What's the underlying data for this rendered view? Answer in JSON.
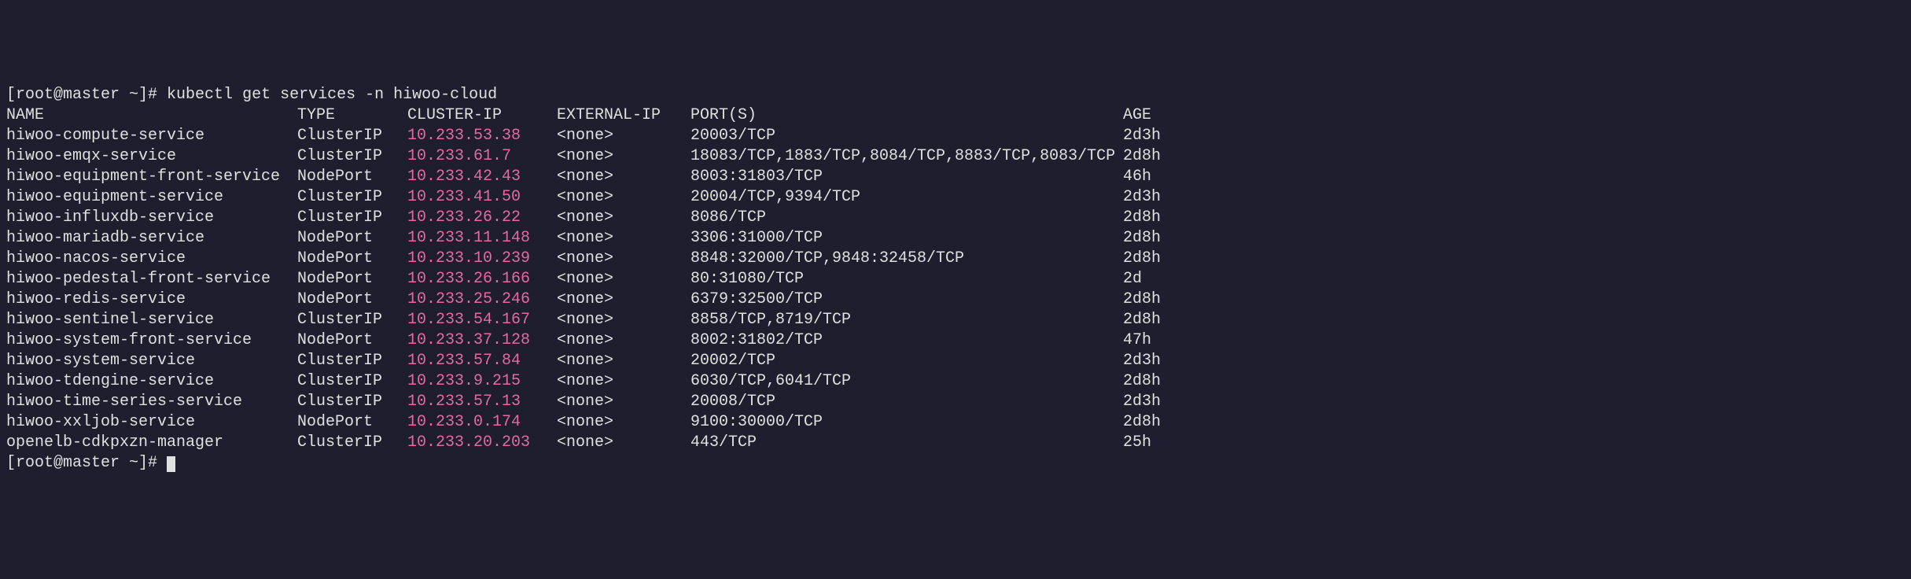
{
  "prompt1": "[root@master ~]# ",
  "command": "kubectl get services -n hiwoo-cloud",
  "prompt2": "[root@master ~]# ",
  "headers": {
    "name": "NAME",
    "type": "TYPE",
    "clusterip": "CLUSTER-IP",
    "externalip": "EXTERNAL-IP",
    "ports": "PORT(S)",
    "age": "AGE"
  },
  "services": [
    {
      "name": "hiwoo-compute-service",
      "type": "ClusterIP",
      "clusterip": "10.233.53.38",
      "externalip": "<none>",
      "ports": "20003/TCP",
      "age": "2d3h"
    },
    {
      "name": "hiwoo-emqx-service",
      "type": "ClusterIP",
      "clusterip": "10.233.61.7",
      "externalip": "<none>",
      "ports": "18083/TCP,1883/TCP,8084/TCP,8883/TCP,8083/TCP",
      "age": "2d8h"
    },
    {
      "name": "hiwoo-equipment-front-service",
      "type": "NodePort",
      "clusterip": "10.233.42.43",
      "externalip": "<none>",
      "ports": "8003:31803/TCP",
      "age": "46h"
    },
    {
      "name": "hiwoo-equipment-service",
      "type": "ClusterIP",
      "clusterip": "10.233.41.50",
      "externalip": "<none>",
      "ports": "20004/TCP,9394/TCP",
      "age": "2d3h"
    },
    {
      "name": "hiwoo-influxdb-service",
      "type": "ClusterIP",
      "clusterip": "10.233.26.22",
      "externalip": "<none>",
      "ports": "8086/TCP",
      "age": "2d8h"
    },
    {
      "name": "hiwoo-mariadb-service",
      "type": "NodePort",
      "clusterip": "10.233.11.148",
      "externalip": "<none>",
      "ports": "3306:31000/TCP",
      "age": "2d8h"
    },
    {
      "name": "hiwoo-nacos-service",
      "type": "NodePort",
      "clusterip": "10.233.10.239",
      "externalip": "<none>",
      "ports": "8848:32000/TCP,9848:32458/TCP",
      "age": "2d8h"
    },
    {
      "name": "hiwoo-pedestal-front-service",
      "type": "NodePort",
      "clusterip": "10.233.26.166",
      "externalip": "<none>",
      "ports": "80:31080/TCP",
      "age": "2d"
    },
    {
      "name": "hiwoo-redis-service",
      "type": "NodePort",
      "clusterip": "10.233.25.246",
      "externalip": "<none>",
      "ports": "6379:32500/TCP",
      "age": "2d8h"
    },
    {
      "name": "hiwoo-sentinel-service",
      "type": "ClusterIP",
      "clusterip": "10.233.54.167",
      "externalip": "<none>",
      "ports": "8858/TCP,8719/TCP",
      "age": "2d8h"
    },
    {
      "name": "hiwoo-system-front-service",
      "type": "NodePort",
      "clusterip": "10.233.37.128",
      "externalip": "<none>",
      "ports": "8002:31802/TCP",
      "age": "47h"
    },
    {
      "name": "hiwoo-system-service",
      "type": "ClusterIP",
      "clusterip": "10.233.57.84",
      "externalip": "<none>",
      "ports": "20002/TCP",
      "age": "2d3h"
    },
    {
      "name": "hiwoo-tdengine-service",
      "type": "ClusterIP",
      "clusterip": "10.233.9.215",
      "externalip": "<none>",
      "ports": "6030/TCP,6041/TCP",
      "age": "2d8h"
    },
    {
      "name": "hiwoo-time-series-service",
      "type": "ClusterIP",
      "clusterip": "10.233.57.13",
      "externalip": "<none>",
      "ports": "20008/TCP",
      "age": "2d3h"
    },
    {
      "name": "hiwoo-xxljob-service",
      "type": "NodePort",
      "clusterip": "10.233.0.174",
      "externalip": "<none>",
      "ports": "9100:30000/TCP",
      "age": "2d8h"
    },
    {
      "name": "openelb-cdkpxzn-manager",
      "type": "ClusterIP",
      "clusterip": "10.233.20.203",
      "externalip": "<none>",
      "ports": "443/TCP",
      "age": "25h"
    }
  ]
}
